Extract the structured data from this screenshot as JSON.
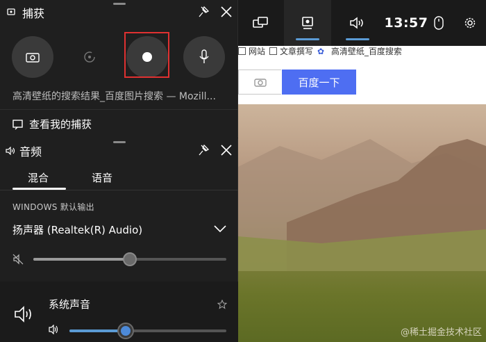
{
  "taskbar": {
    "clock": "13:57",
    "items": [
      {
        "icon": "widgets-icon"
      },
      {
        "icon": "capture-icon",
        "active": true
      },
      {
        "icon": "audio-icon",
        "active": true
      },
      {
        "icon": "mouse-icon"
      },
      {
        "icon": "gear-icon"
      }
    ]
  },
  "browser": {
    "bookmarks": [
      "网站",
      "文章撰写",
      "高清壁纸_百度搜索"
    ],
    "search_button": "百度一下"
  },
  "capture": {
    "title": "捕获",
    "window_name": "高清壁纸的搜索结果_百度图片搜索 — Mozill...",
    "gallery_link": "查看我的捕获"
  },
  "audio": {
    "title": "音频",
    "tabs": [
      "混合",
      "语音"
    ],
    "output_label": "WINDOWS 默认输出",
    "device": "扬声器 (Realtek(R) Audio)",
    "master_volume": 0.5,
    "app_name": "系统声音",
    "app_volume": 0.36
  },
  "watermark": "@稀土掘金技术社区"
}
